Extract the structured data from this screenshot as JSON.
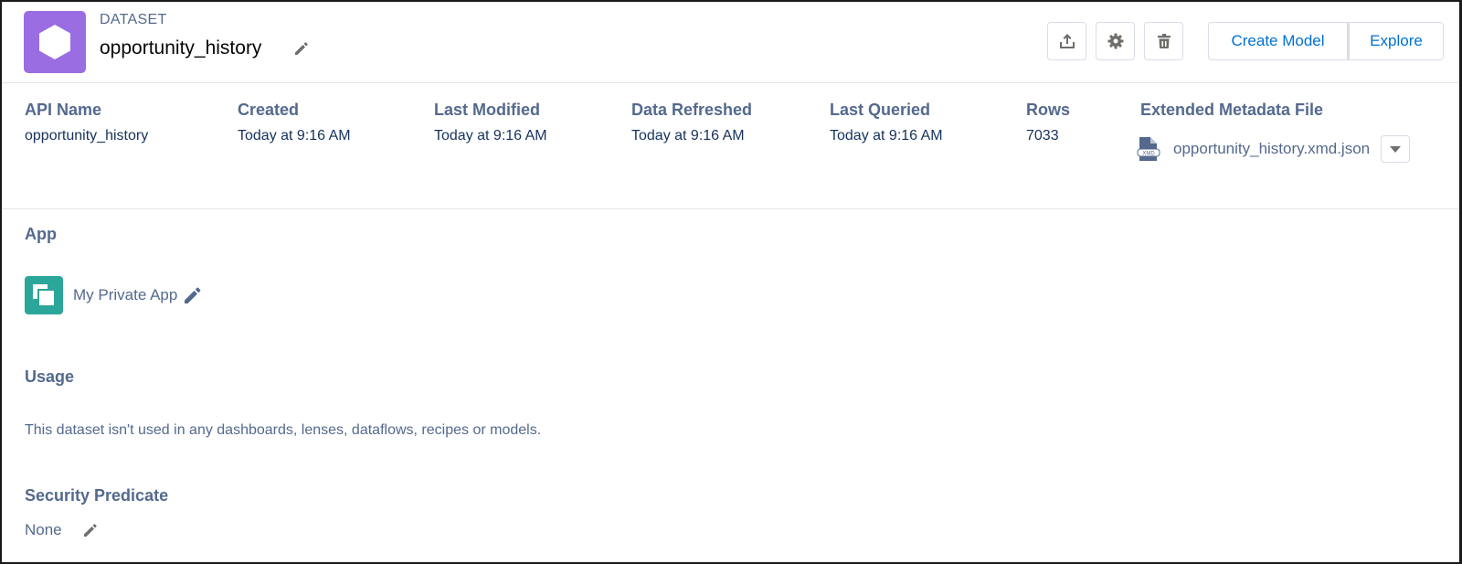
{
  "header": {
    "kicker": "DATASET",
    "title": "opportunity_history",
    "icons": {
      "dataset": "hexagon-icon",
      "edit_title": "pencil-icon",
      "upload": "upload-icon",
      "settings": "gear-icon",
      "delete": "trash-icon"
    },
    "buttons": {
      "create_model": "Create Model",
      "explore": "Explore"
    }
  },
  "metadata": {
    "columns": [
      {
        "label": "API Name",
        "value": "opportunity_history"
      },
      {
        "label": "Created",
        "value": "Today at 9:16 AM"
      },
      {
        "label": "Last Modified",
        "value": "Today at 9:16 AM"
      },
      {
        "label": "Data Refreshed",
        "value": "Today at 9:16 AM"
      },
      {
        "label": "Last Queried",
        "value": "Today at 9:16 AM"
      },
      {
        "label": "Rows",
        "value": "7033"
      }
    ],
    "xmd": {
      "label": "Extended Metadata File",
      "file_name": "opportunity_history.xmd.json",
      "icon_badge": "XMD"
    }
  },
  "app": {
    "label": "App",
    "name": "My Private App"
  },
  "usage": {
    "label": "Usage",
    "text": "This dataset isn't used in any dashboards, lenses, dataflows, recipes or models."
  },
  "security_predicate": {
    "label": "Security Predicate",
    "value": "None"
  },
  "colors": {
    "dataset_icon": "#9a6de2",
    "app_icon": "#2ba69a",
    "link": "#0070d2",
    "label": "#54698d",
    "text": "#16325c"
  }
}
